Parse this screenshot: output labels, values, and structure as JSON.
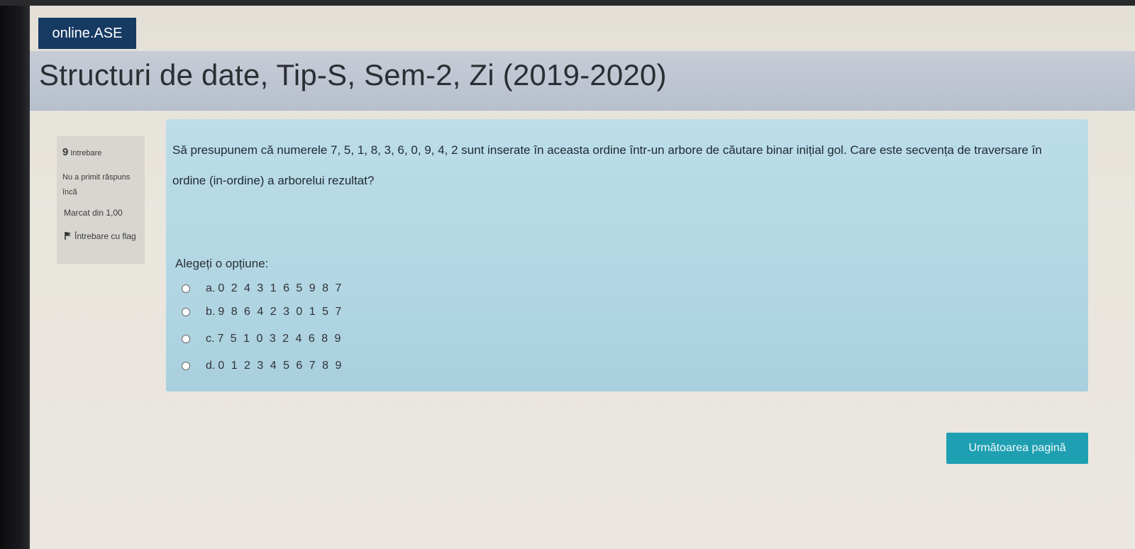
{
  "site": {
    "logo_text": "online.ASE"
  },
  "course": {
    "title": "Structuri de date, Tip-S, Sem-2, Zi (2019-2020)"
  },
  "question_info": {
    "number": "9",
    "number_label": "Intrebare",
    "state": "Nu a primit răspuns încă",
    "grade": "Marcat din 1,00",
    "flag_label": "Întrebare cu flag"
  },
  "question": {
    "text": "Să presupunem că numerele 7, 5, 1, 8, 3, 6, 0, 9, 4, 2 sunt inserate în aceasta ordine într-un arbore de căutare binar inițial gol. Care este secvența de traversare în ordine (in-ordine) a arborelui rezultat?",
    "prompt": "Alegeți o opțiune:",
    "answers": [
      {
        "letter": "a.",
        "text": "0 2 4 3 1 6 5 9 8 7"
      },
      {
        "letter": "b.",
        "text": "9 8 6 4 2 3 0 1 5 7"
      },
      {
        "letter": "c.",
        "text": "7 5 1 0 3 2 4 6 8 9"
      },
      {
        "letter": "d.",
        "text": "0 1 2 3 4 5 6 7 8 9"
      }
    ]
  },
  "navigation": {
    "next_label": "Următoarea pagină"
  },
  "colors": {
    "logo_bg": "#173a63",
    "question_bg": "#b7d9e6",
    "button_bg": "#1f9fb2",
    "info_bg": "#d8d6d0"
  }
}
